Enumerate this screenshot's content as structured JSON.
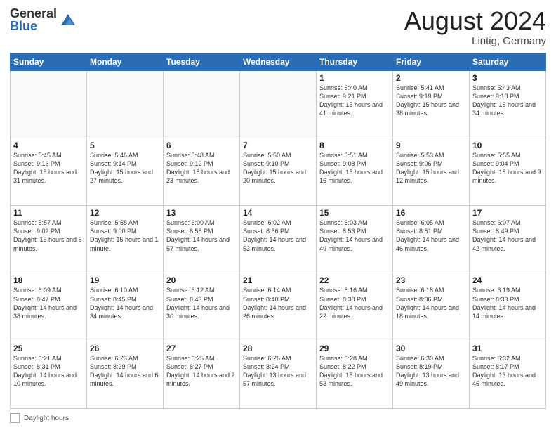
{
  "header": {
    "logo_general": "General",
    "logo_blue": "Blue",
    "month_title": "August 2024",
    "location": "Lintig, Germany"
  },
  "days_of_week": [
    "Sunday",
    "Monday",
    "Tuesday",
    "Wednesday",
    "Thursday",
    "Friday",
    "Saturday"
  ],
  "footer": {
    "label": "Daylight hours"
  },
  "weeks": [
    [
      {
        "day": "",
        "info": ""
      },
      {
        "day": "",
        "info": ""
      },
      {
        "day": "",
        "info": ""
      },
      {
        "day": "",
        "info": ""
      },
      {
        "day": "1",
        "info": "Sunrise: 5:40 AM\nSunset: 9:21 PM\nDaylight: 15 hours\nand 41 minutes."
      },
      {
        "day": "2",
        "info": "Sunrise: 5:41 AM\nSunset: 9:19 PM\nDaylight: 15 hours\nand 38 minutes."
      },
      {
        "day": "3",
        "info": "Sunrise: 5:43 AM\nSunset: 9:18 PM\nDaylight: 15 hours\nand 34 minutes."
      }
    ],
    [
      {
        "day": "4",
        "info": "Sunrise: 5:45 AM\nSunset: 9:16 PM\nDaylight: 15 hours\nand 31 minutes."
      },
      {
        "day": "5",
        "info": "Sunrise: 5:46 AM\nSunset: 9:14 PM\nDaylight: 15 hours\nand 27 minutes."
      },
      {
        "day": "6",
        "info": "Sunrise: 5:48 AM\nSunset: 9:12 PM\nDaylight: 15 hours\nand 23 minutes."
      },
      {
        "day": "7",
        "info": "Sunrise: 5:50 AM\nSunset: 9:10 PM\nDaylight: 15 hours\nand 20 minutes."
      },
      {
        "day": "8",
        "info": "Sunrise: 5:51 AM\nSunset: 9:08 PM\nDaylight: 15 hours\nand 16 minutes."
      },
      {
        "day": "9",
        "info": "Sunrise: 5:53 AM\nSunset: 9:06 PM\nDaylight: 15 hours\nand 12 minutes."
      },
      {
        "day": "10",
        "info": "Sunrise: 5:55 AM\nSunset: 9:04 PM\nDaylight: 15 hours\nand 9 minutes."
      }
    ],
    [
      {
        "day": "11",
        "info": "Sunrise: 5:57 AM\nSunset: 9:02 PM\nDaylight: 15 hours\nand 5 minutes."
      },
      {
        "day": "12",
        "info": "Sunrise: 5:58 AM\nSunset: 9:00 PM\nDaylight: 15 hours\nand 1 minute."
      },
      {
        "day": "13",
        "info": "Sunrise: 6:00 AM\nSunset: 8:58 PM\nDaylight: 14 hours\nand 57 minutes."
      },
      {
        "day": "14",
        "info": "Sunrise: 6:02 AM\nSunset: 8:56 PM\nDaylight: 14 hours\nand 53 minutes."
      },
      {
        "day": "15",
        "info": "Sunrise: 6:03 AM\nSunset: 8:53 PM\nDaylight: 14 hours\nand 49 minutes."
      },
      {
        "day": "16",
        "info": "Sunrise: 6:05 AM\nSunset: 8:51 PM\nDaylight: 14 hours\nand 46 minutes."
      },
      {
        "day": "17",
        "info": "Sunrise: 6:07 AM\nSunset: 8:49 PM\nDaylight: 14 hours\nand 42 minutes."
      }
    ],
    [
      {
        "day": "18",
        "info": "Sunrise: 6:09 AM\nSunset: 8:47 PM\nDaylight: 14 hours\nand 38 minutes."
      },
      {
        "day": "19",
        "info": "Sunrise: 6:10 AM\nSunset: 8:45 PM\nDaylight: 14 hours\nand 34 minutes."
      },
      {
        "day": "20",
        "info": "Sunrise: 6:12 AM\nSunset: 8:43 PM\nDaylight: 14 hours\nand 30 minutes."
      },
      {
        "day": "21",
        "info": "Sunrise: 6:14 AM\nSunset: 8:40 PM\nDaylight: 14 hours\nand 26 minutes."
      },
      {
        "day": "22",
        "info": "Sunrise: 6:16 AM\nSunset: 8:38 PM\nDaylight: 14 hours\nand 22 minutes."
      },
      {
        "day": "23",
        "info": "Sunrise: 6:18 AM\nSunset: 8:36 PM\nDaylight: 14 hours\nand 18 minutes."
      },
      {
        "day": "24",
        "info": "Sunrise: 6:19 AM\nSunset: 8:33 PM\nDaylight: 14 hours\nand 14 minutes."
      }
    ],
    [
      {
        "day": "25",
        "info": "Sunrise: 6:21 AM\nSunset: 8:31 PM\nDaylight: 14 hours\nand 10 minutes."
      },
      {
        "day": "26",
        "info": "Sunrise: 6:23 AM\nSunset: 8:29 PM\nDaylight: 14 hours\nand 6 minutes."
      },
      {
        "day": "27",
        "info": "Sunrise: 6:25 AM\nSunset: 8:27 PM\nDaylight: 14 hours\nand 2 minutes."
      },
      {
        "day": "28",
        "info": "Sunrise: 6:26 AM\nSunset: 8:24 PM\nDaylight: 13 hours\nand 57 minutes."
      },
      {
        "day": "29",
        "info": "Sunrise: 6:28 AM\nSunset: 8:22 PM\nDaylight: 13 hours\nand 53 minutes."
      },
      {
        "day": "30",
        "info": "Sunrise: 6:30 AM\nSunset: 8:19 PM\nDaylight: 13 hours\nand 49 minutes."
      },
      {
        "day": "31",
        "info": "Sunrise: 6:32 AM\nSunset: 8:17 PM\nDaylight: 13 hours\nand 45 minutes."
      }
    ]
  ]
}
